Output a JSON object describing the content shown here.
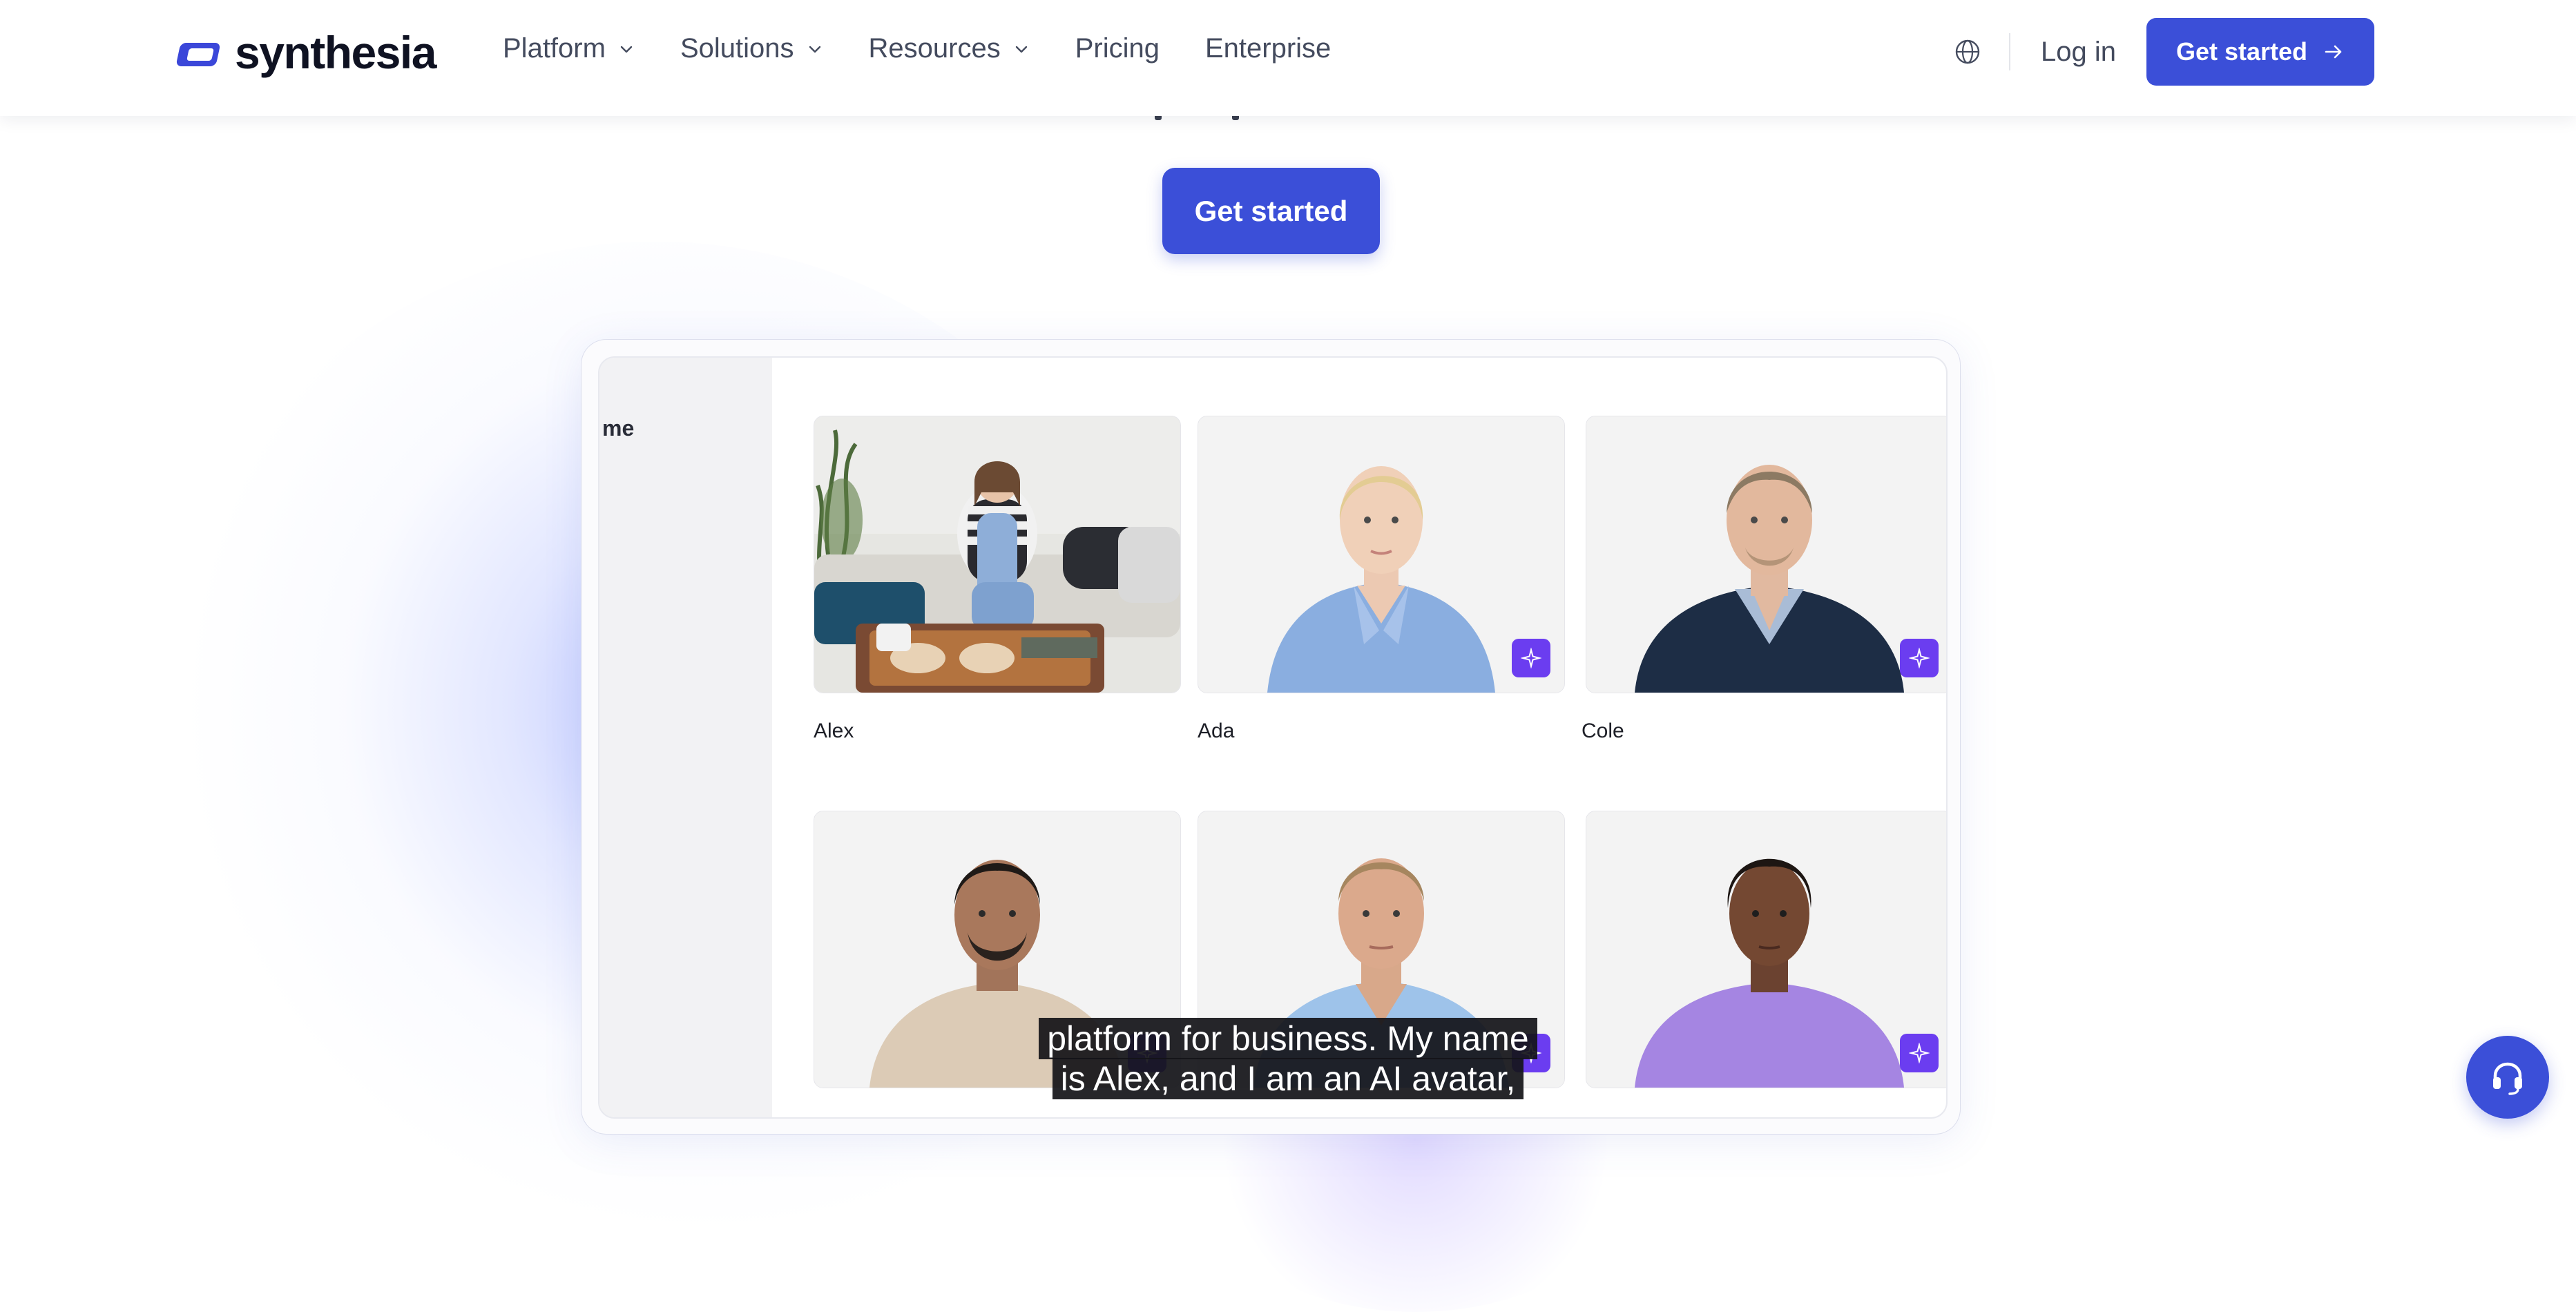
{
  "brand": {
    "name": "synthesia",
    "accent": "#3b4fd8",
    "badge_color": "#6b3df0"
  },
  "nav": {
    "items": [
      {
        "label": "Platform",
        "has_dropdown": true
      },
      {
        "label": "Solutions",
        "has_dropdown": true
      },
      {
        "label": "Resources",
        "has_dropdown": true
      },
      {
        "label": "Pricing",
        "has_dropdown": false
      },
      {
        "label": "Enterprise",
        "has_dropdown": false
      }
    ],
    "login_label": "Log in",
    "cta_label": "Get started",
    "icons": {
      "language": "globe-icon",
      "cta": "arrow-right-icon",
      "dropdown": "chevron-down-icon"
    }
  },
  "hero": {
    "cta_label": "Get started"
  },
  "preview": {
    "sidebar_label": "me",
    "avatars": [
      {
        "name": "Alex",
        "badge": false
      },
      {
        "name": "Ada",
        "badge": true
      },
      {
        "name": "Cole",
        "badge": true
      },
      {
        "name": "",
        "badge": true
      },
      {
        "name": "",
        "badge": true
      },
      {
        "name": "",
        "badge": true
      }
    ],
    "badge_icon": "sparkle-icon"
  },
  "captions": {
    "line1": "platform for business. My name",
    "line2": "is Alex, and I am an AI avatar,"
  },
  "support": {
    "icon": "headset-icon"
  }
}
